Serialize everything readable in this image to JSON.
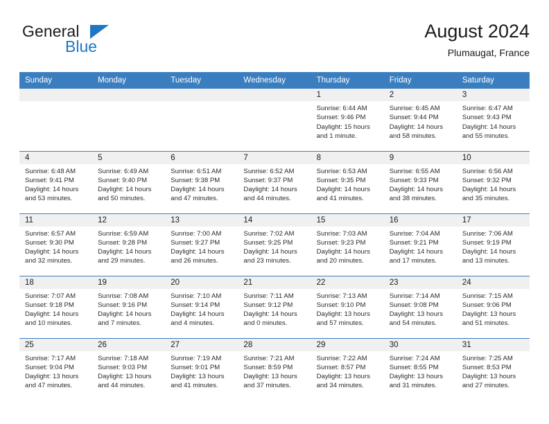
{
  "brand": {
    "name_part1": "General",
    "name_part2": "Blue",
    "flag_icon": "triangle-flag-icon",
    "accent_color": "#1f76c2"
  },
  "header": {
    "title": "August 2024",
    "subtitle": "Plumaugat, France"
  },
  "calendar": {
    "header_bg": "#3a7ebf",
    "daynum_bg": "#f0f0f0",
    "weekdays": [
      "Sunday",
      "Monday",
      "Tuesday",
      "Wednesday",
      "Thursday",
      "Friday",
      "Saturday"
    ],
    "weeks": [
      [
        {
          "day": "",
          "empty": true,
          "sunrise": "",
          "sunset": "",
          "daylight_line1": "",
          "daylight_line2": ""
        },
        {
          "day": "",
          "empty": true,
          "sunrise": "",
          "sunset": "",
          "daylight_line1": "",
          "daylight_line2": ""
        },
        {
          "day": "",
          "empty": true,
          "sunrise": "",
          "sunset": "",
          "daylight_line1": "",
          "daylight_line2": ""
        },
        {
          "day": "",
          "empty": true,
          "sunrise": "",
          "sunset": "",
          "daylight_line1": "",
          "daylight_line2": ""
        },
        {
          "day": "1",
          "sunrise": "Sunrise: 6:44 AM",
          "sunset": "Sunset: 9:46 PM",
          "daylight_line1": "Daylight: 15 hours",
          "daylight_line2": "and 1 minute."
        },
        {
          "day": "2",
          "sunrise": "Sunrise: 6:45 AM",
          "sunset": "Sunset: 9:44 PM",
          "daylight_line1": "Daylight: 14 hours",
          "daylight_line2": "and 58 minutes."
        },
        {
          "day": "3",
          "sunrise": "Sunrise: 6:47 AM",
          "sunset": "Sunset: 9:43 PM",
          "daylight_line1": "Daylight: 14 hours",
          "daylight_line2": "and 55 minutes."
        }
      ],
      [
        {
          "day": "4",
          "sunrise": "Sunrise: 6:48 AM",
          "sunset": "Sunset: 9:41 PM",
          "daylight_line1": "Daylight: 14 hours",
          "daylight_line2": "and 53 minutes."
        },
        {
          "day": "5",
          "sunrise": "Sunrise: 6:49 AM",
          "sunset": "Sunset: 9:40 PM",
          "daylight_line1": "Daylight: 14 hours",
          "daylight_line2": "and 50 minutes."
        },
        {
          "day": "6",
          "sunrise": "Sunrise: 6:51 AM",
          "sunset": "Sunset: 9:38 PM",
          "daylight_line1": "Daylight: 14 hours",
          "daylight_line2": "and 47 minutes."
        },
        {
          "day": "7",
          "sunrise": "Sunrise: 6:52 AM",
          "sunset": "Sunset: 9:37 PM",
          "daylight_line1": "Daylight: 14 hours",
          "daylight_line2": "and 44 minutes."
        },
        {
          "day": "8",
          "sunrise": "Sunrise: 6:53 AM",
          "sunset": "Sunset: 9:35 PM",
          "daylight_line1": "Daylight: 14 hours",
          "daylight_line2": "and 41 minutes."
        },
        {
          "day": "9",
          "sunrise": "Sunrise: 6:55 AM",
          "sunset": "Sunset: 9:33 PM",
          "daylight_line1": "Daylight: 14 hours",
          "daylight_line2": "and 38 minutes."
        },
        {
          "day": "10",
          "sunrise": "Sunrise: 6:56 AM",
          "sunset": "Sunset: 9:32 PM",
          "daylight_line1": "Daylight: 14 hours",
          "daylight_line2": "and 35 minutes."
        }
      ],
      [
        {
          "day": "11",
          "sunrise": "Sunrise: 6:57 AM",
          "sunset": "Sunset: 9:30 PM",
          "daylight_line1": "Daylight: 14 hours",
          "daylight_line2": "and 32 minutes."
        },
        {
          "day": "12",
          "sunrise": "Sunrise: 6:59 AM",
          "sunset": "Sunset: 9:28 PM",
          "daylight_line1": "Daylight: 14 hours",
          "daylight_line2": "and 29 minutes."
        },
        {
          "day": "13",
          "sunrise": "Sunrise: 7:00 AM",
          "sunset": "Sunset: 9:27 PM",
          "daylight_line1": "Daylight: 14 hours",
          "daylight_line2": "and 26 minutes."
        },
        {
          "day": "14",
          "sunrise": "Sunrise: 7:02 AM",
          "sunset": "Sunset: 9:25 PM",
          "daylight_line1": "Daylight: 14 hours",
          "daylight_line2": "and 23 minutes."
        },
        {
          "day": "15",
          "sunrise": "Sunrise: 7:03 AM",
          "sunset": "Sunset: 9:23 PM",
          "daylight_line1": "Daylight: 14 hours",
          "daylight_line2": "and 20 minutes."
        },
        {
          "day": "16",
          "sunrise": "Sunrise: 7:04 AM",
          "sunset": "Sunset: 9:21 PM",
          "daylight_line1": "Daylight: 14 hours",
          "daylight_line2": "and 17 minutes."
        },
        {
          "day": "17",
          "sunrise": "Sunrise: 7:06 AM",
          "sunset": "Sunset: 9:19 PM",
          "daylight_line1": "Daylight: 14 hours",
          "daylight_line2": "and 13 minutes."
        }
      ],
      [
        {
          "day": "18",
          "sunrise": "Sunrise: 7:07 AM",
          "sunset": "Sunset: 9:18 PM",
          "daylight_line1": "Daylight: 14 hours",
          "daylight_line2": "and 10 minutes."
        },
        {
          "day": "19",
          "sunrise": "Sunrise: 7:08 AM",
          "sunset": "Sunset: 9:16 PM",
          "daylight_line1": "Daylight: 14 hours",
          "daylight_line2": "and 7 minutes."
        },
        {
          "day": "20",
          "sunrise": "Sunrise: 7:10 AM",
          "sunset": "Sunset: 9:14 PM",
          "daylight_line1": "Daylight: 14 hours",
          "daylight_line2": "and 4 minutes."
        },
        {
          "day": "21",
          "sunrise": "Sunrise: 7:11 AM",
          "sunset": "Sunset: 9:12 PM",
          "daylight_line1": "Daylight: 14 hours",
          "daylight_line2": "and 0 minutes."
        },
        {
          "day": "22",
          "sunrise": "Sunrise: 7:13 AM",
          "sunset": "Sunset: 9:10 PM",
          "daylight_line1": "Daylight: 13 hours",
          "daylight_line2": "and 57 minutes."
        },
        {
          "day": "23",
          "sunrise": "Sunrise: 7:14 AM",
          "sunset": "Sunset: 9:08 PM",
          "daylight_line1": "Daylight: 13 hours",
          "daylight_line2": "and 54 minutes."
        },
        {
          "day": "24",
          "sunrise": "Sunrise: 7:15 AM",
          "sunset": "Sunset: 9:06 PM",
          "daylight_line1": "Daylight: 13 hours",
          "daylight_line2": "and 51 minutes."
        }
      ],
      [
        {
          "day": "25",
          "sunrise": "Sunrise: 7:17 AM",
          "sunset": "Sunset: 9:04 PM",
          "daylight_line1": "Daylight: 13 hours",
          "daylight_line2": "and 47 minutes."
        },
        {
          "day": "26",
          "sunrise": "Sunrise: 7:18 AM",
          "sunset": "Sunset: 9:03 PM",
          "daylight_line1": "Daylight: 13 hours",
          "daylight_line2": "and 44 minutes."
        },
        {
          "day": "27",
          "sunrise": "Sunrise: 7:19 AM",
          "sunset": "Sunset: 9:01 PM",
          "daylight_line1": "Daylight: 13 hours",
          "daylight_line2": "and 41 minutes."
        },
        {
          "day": "28",
          "sunrise": "Sunrise: 7:21 AM",
          "sunset": "Sunset: 8:59 PM",
          "daylight_line1": "Daylight: 13 hours",
          "daylight_line2": "and 37 minutes."
        },
        {
          "day": "29",
          "sunrise": "Sunrise: 7:22 AM",
          "sunset": "Sunset: 8:57 PM",
          "daylight_line1": "Daylight: 13 hours",
          "daylight_line2": "and 34 minutes."
        },
        {
          "day": "30",
          "sunrise": "Sunrise: 7:24 AM",
          "sunset": "Sunset: 8:55 PM",
          "daylight_line1": "Daylight: 13 hours",
          "daylight_line2": "and 31 minutes."
        },
        {
          "day": "31",
          "sunrise": "Sunrise: 7:25 AM",
          "sunset": "Sunset: 8:53 PM",
          "daylight_line1": "Daylight: 13 hours",
          "daylight_line2": "and 27 minutes."
        }
      ]
    ]
  }
}
